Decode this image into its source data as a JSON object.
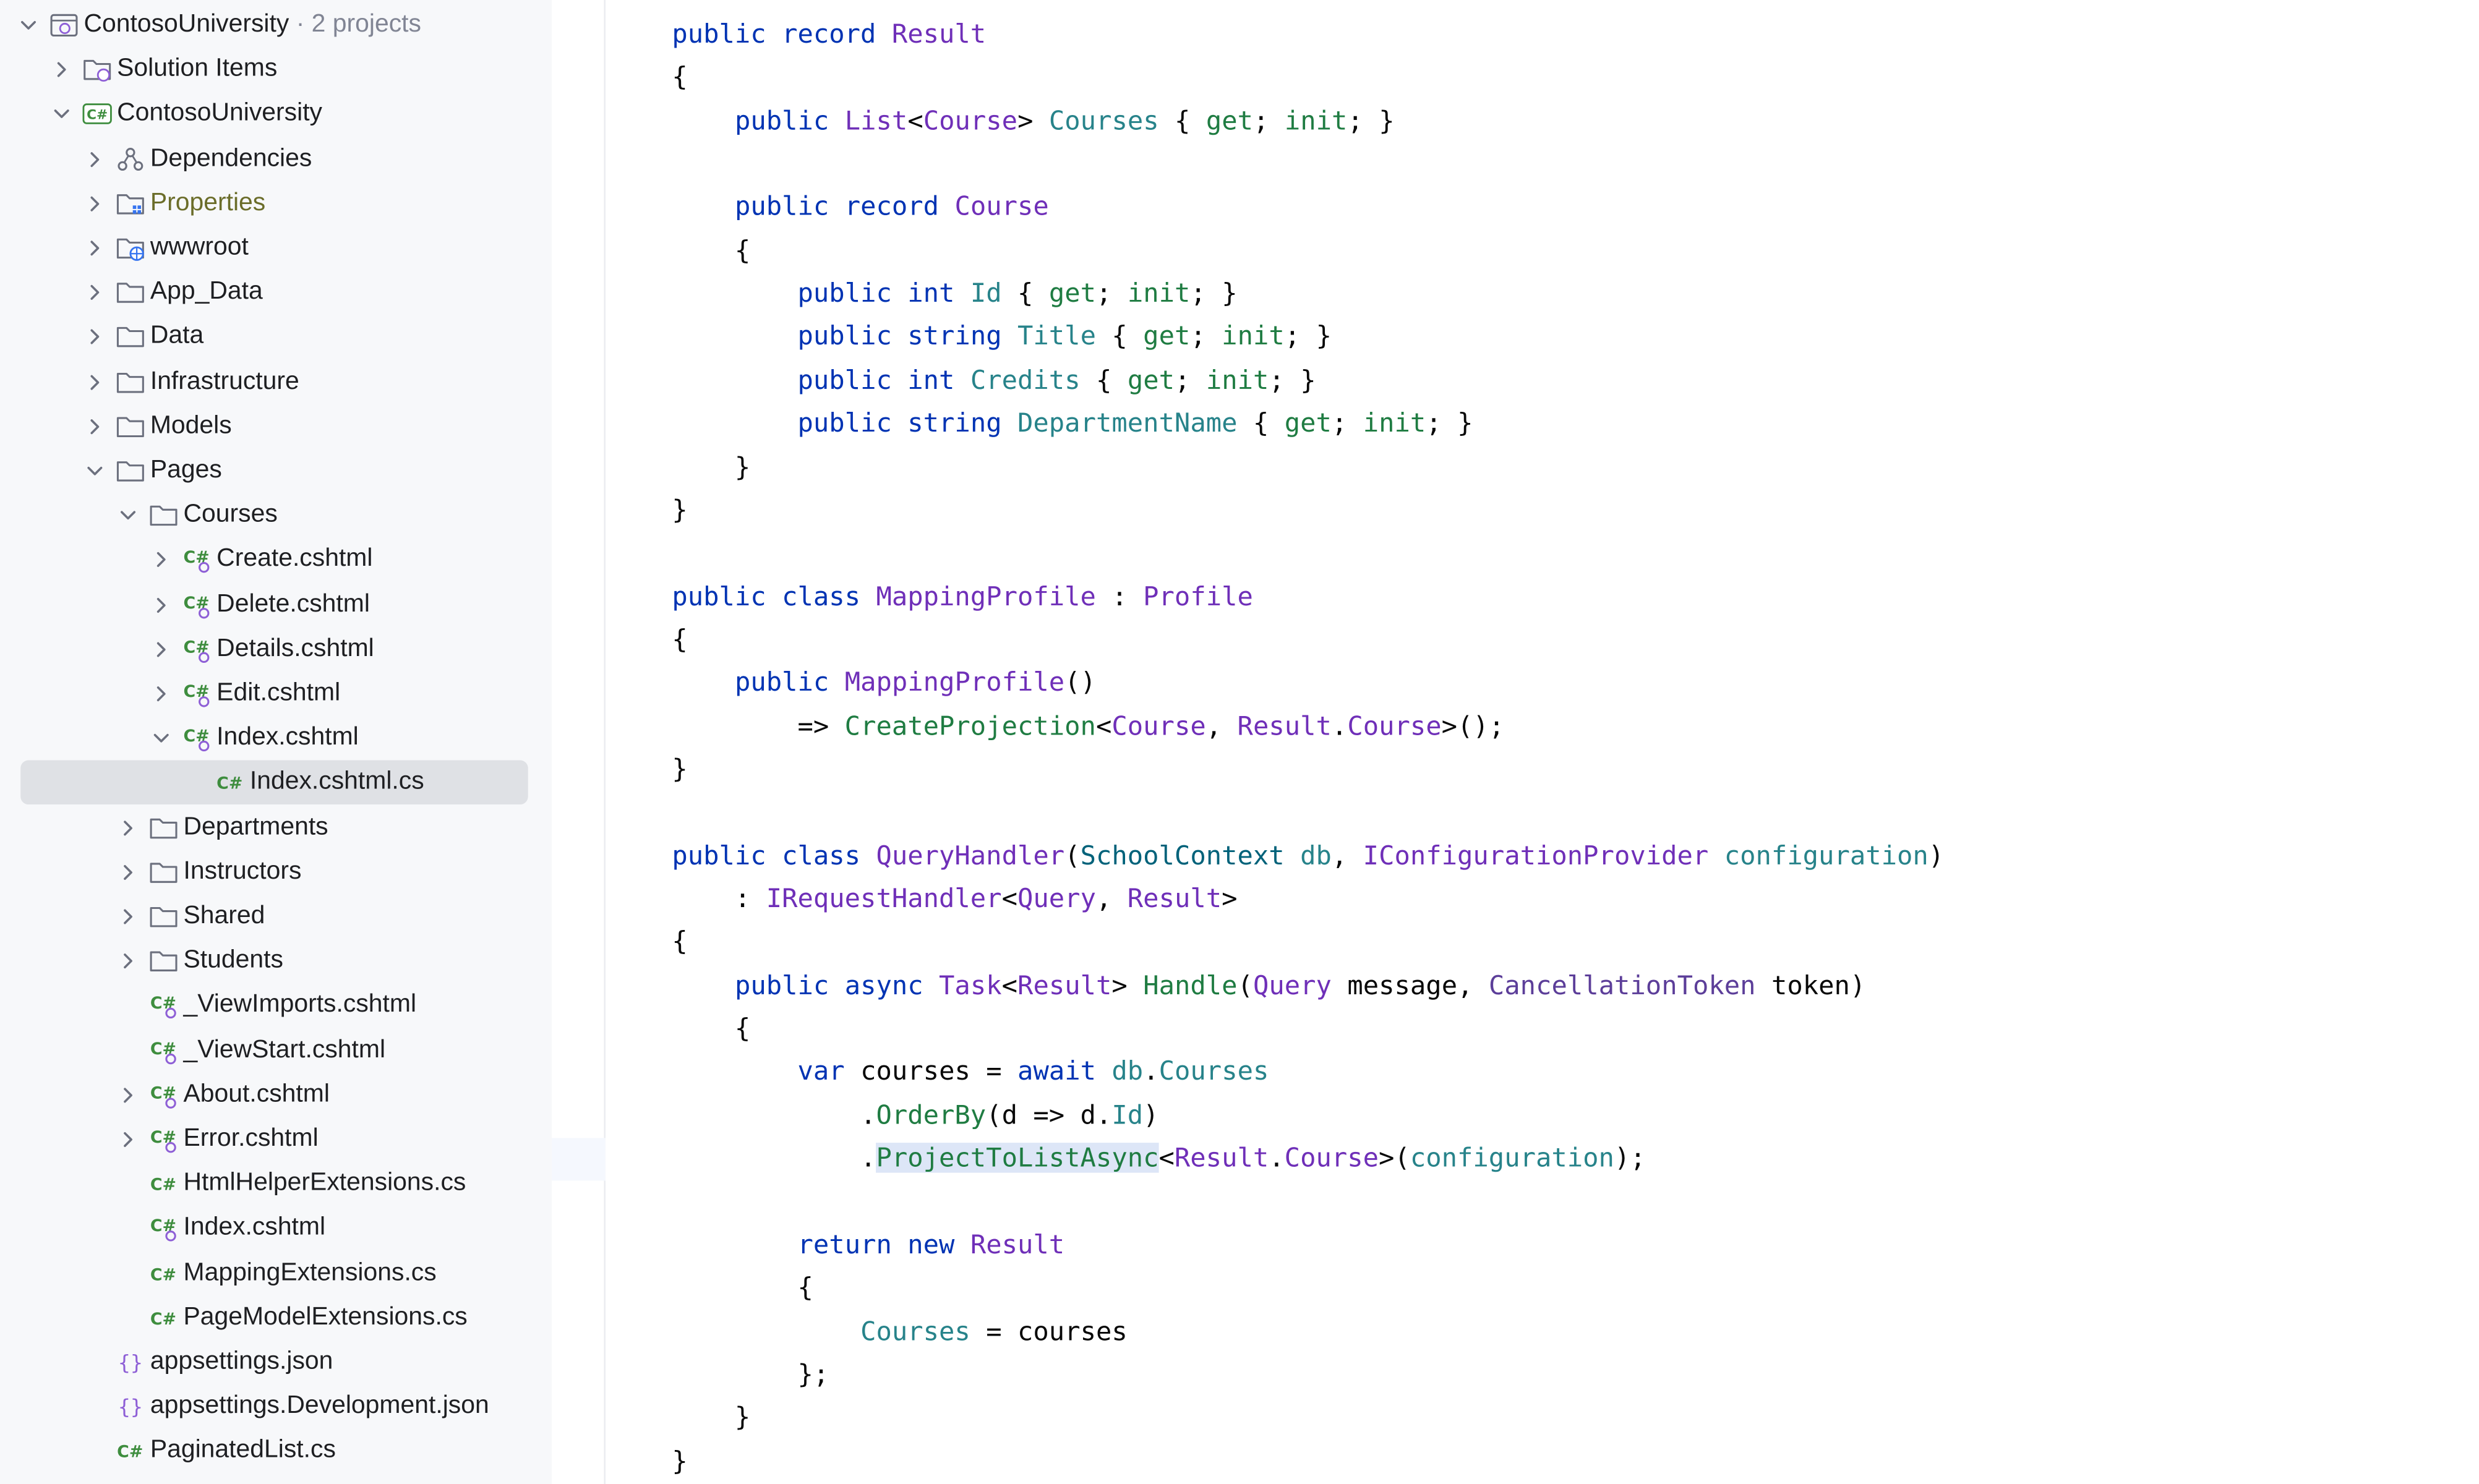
{
  "sidebar": {
    "root": {
      "label": "ContosoUniversity",
      "suffix": " · 2 projects"
    },
    "rows": [
      {
        "label": "Solution Items"
      },
      {
        "label": "ContosoUniversity",
        "badge": "C#"
      },
      {
        "label": "Dependencies"
      },
      {
        "label": "Properties"
      },
      {
        "label": "wwwroot"
      },
      {
        "label": "App_Data"
      },
      {
        "label": "Data"
      },
      {
        "label": "Infrastructure"
      },
      {
        "label": "Models"
      },
      {
        "label": "Pages"
      },
      {
        "label": "Courses"
      },
      {
        "label": "Create.cshtml",
        "badge": "C#"
      },
      {
        "label": "Delete.cshtml",
        "badge": "C#"
      },
      {
        "label": "Details.cshtml",
        "badge": "C#"
      },
      {
        "label": "Edit.cshtml",
        "badge": "C#"
      },
      {
        "label": "Index.cshtml",
        "badge": "C#"
      },
      {
        "label": "Index.cshtml.cs",
        "badge": "C#"
      },
      {
        "label": "Departments"
      },
      {
        "label": "Instructors"
      },
      {
        "label": "Shared"
      },
      {
        "label": "Students"
      },
      {
        "label": "_ViewImports.cshtml",
        "badge": "C#"
      },
      {
        "label": "_ViewStart.cshtml",
        "badge": "C#"
      },
      {
        "label": "About.cshtml",
        "badge": "C#"
      },
      {
        "label": "Error.cshtml",
        "badge": "C#"
      },
      {
        "label": "HtmlHelperExtensions.cs",
        "badge": "C#"
      },
      {
        "label": "Index.cshtml",
        "badge": "C#"
      },
      {
        "label": "MappingExtensions.cs",
        "badge": "C#"
      },
      {
        "label": "PageModelExtensions.cs",
        "badge": "C#"
      },
      {
        "label": "appsettings.json",
        "badge": "{}"
      },
      {
        "label": "appsettings.Development.json",
        "badge": "{}"
      },
      {
        "label": "PaginatedList.cs",
        "badge": "C#"
      }
    ]
  },
  "colors": {
    "keyword": "#0033b3",
    "type": "#6f2fb8",
    "property": "#27838a",
    "accessor": "#1f7c42",
    "selection": "#dfe1e5",
    "caret_line": "#f5f8fe",
    "identifier_highlight": "#dde6f7"
  },
  "editor": {
    "lines": [
      [
        [
          "kw",
          "public record "
        ],
        [
          "ty",
          "Result"
        ]
      ],
      [
        [
          "pl",
          "{"
        ]
      ],
      [
        [
          "pl",
          "    "
        ],
        [
          "kw",
          "public "
        ],
        [
          "ty",
          "List"
        ],
        [
          "pl",
          "<"
        ],
        [
          "ty",
          "Course"
        ],
        [
          "pl",
          "> "
        ],
        [
          "pr",
          "Courses"
        ],
        [
          "pl",
          " { "
        ],
        [
          "ac",
          "get"
        ],
        [
          "pl",
          "; "
        ],
        [
          "ac",
          "init"
        ],
        [
          "pl",
          "; }"
        ]
      ],
      [],
      [
        [
          "pl",
          "    "
        ],
        [
          "kw",
          "public record "
        ],
        [
          "ty",
          "Course"
        ]
      ],
      [
        [
          "pl",
          "    {"
        ]
      ],
      [
        [
          "pl",
          "        "
        ],
        [
          "kw",
          "public int "
        ],
        [
          "pr",
          "Id"
        ],
        [
          "pl",
          " { "
        ],
        [
          "ac",
          "get"
        ],
        [
          "pl",
          "; "
        ],
        [
          "ac",
          "init"
        ],
        [
          "pl",
          "; }"
        ]
      ],
      [
        [
          "pl",
          "        "
        ],
        [
          "kw",
          "public string "
        ],
        [
          "pr",
          "Title"
        ],
        [
          "pl",
          " { "
        ],
        [
          "ac",
          "get"
        ],
        [
          "pl",
          "; "
        ],
        [
          "ac",
          "init"
        ],
        [
          "pl",
          "; }"
        ]
      ],
      [
        [
          "pl",
          "        "
        ],
        [
          "kw",
          "public int "
        ],
        [
          "pr",
          "Credits"
        ],
        [
          "pl",
          " { "
        ],
        [
          "ac",
          "get"
        ],
        [
          "pl",
          "; "
        ],
        [
          "ac",
          "init"
        ],
        [
          "pl",
          "; }"
        ]
      ],
      [
        [
          "pl",
          "        "
        ],
        [
          "kw",
          "public string "
        ],
        [
          "pr",
          "DepartmentName"
        ],
        [
          "pl",
          " { "
        ],
        [
          "ac",
          "get"
        ],
        [
          "pl",
          "; "
        ],
        [
          "ac",
          "init"
        ],
        [
          "pl",
          "; }"
        ]
      ],
      [
        [
          "pl",
          "    }"
        ]
      ],
      [
        [
          "pl",
          "}"
        ]
      ],
      [],
      [
        [
          "kw",
          "public class "
        ],
        [
          "ty",
          "MappingProfile"
        ],
        [
          "pl",
          " : "
        ],
        [
          "ty",
          "Profile"
        ]
      ],
      [
        [
          "pl",
          "{"
        ]
      ],
      [
        [
          "pl",
          "    "
        ],
        [
          "kw",
          "public "
        ],
        [
          "ty",
          "MappingProfile"
        ],
        [
          "pl",
          "()"
        ]
      ],
      [
        [
          "pl",
          "        => "
        ],
        [
          "ac",
          "CreateProjection"
        ],
        [
          "pl",
          "<"
        ],
        [
          "ty",
          "Course"
        ],
        [
          "pl",
          ", "
        ],
        [
          "ty",
          "Result"
        ],
        [
          "pl",
          "."
        ],
        [
          "ty",
          "Course"
        ],
        [
          "pl",
          ">();"
        ]
      ],
      [
        [
          "pl",
          "}"
        ]
      ],
      [],
      [
        [
          "kw",
          "public class "
        ],
        [
          "ty",
          "QueryHandler"
        ],
        [
          "pl",
          "("
        ],
        [
          "st",
          "SchoolContext "
        ],
        [
          "pr",
          "db"
        ],
        [
          "pl",
          ", "
        ],
        [
          "ty",
          "IConfigurationProvider "
        ],
        [
          "pr",
          "configuration"
        ],
        [
          "pl",
          ")"
        ]
      ],
      [
        [
          "pl",
          "    : "
        ],
        [
          "ty",
          "IRequestHandler"
        ],
        [
          "pl",
          "<"
        ],
        [
          "ty",
          "Query"
        ],
        [
          "pl",
          ", "
        ],
        [
          "ty",
          "Result"
        ],
        [
          "pl",
          ">"
        ]
      ],
      [
        [
          "pl",
          "{"
        ]
      ],
      [
        [
          "pl",
          "    "
        ],
        [
          "kw",
          "public async "
        ],
        [
          "ty",
          "Task"
        ],
        [
          "pl",
          "<"
        ],
        [
          "ty",
          "Result"
        ],
        [
          "pl",
          "> "
        ],
        [
          "ac",
          "Handle"
        ],
        [
          "pl",
          "("
        ],
        [
          "ty",
          "Query"
        ],
        [
          "pl",
          " message, "
        ],
        [
          "mt",
          "CancellationToken"
        ],
        [
          "pl",
          " token)"
        ]
      ],
      [
        [
          "pl",
          "    {"
        ]
      ],
      [
        [
          "pl",
          "        "
        ],
        [
          "kw",
          "var "
        ],
        [
          "pl",
          "courses = "
        ],
        [
          "kw",
          "await "
        ],
        [
          "pr",
          "db"
        ],
        [
          "pl",
          "."
        ],
        [
          "pr",
          "Courses"
        ]
      ],
      [
        [
          "pl",
          "            ."
        ],
        [
          "ac",
          "OrderBy"
        ],
        [
          "pl",
          "(d => d."
        ],
        [
          "pr",
          "Id"
        ],
        [
          "pl",
          ")"
        ]
      ],
      [
        [
          "pl",
          "            ."
        ],
        [
          "hl",
          "ProjectToListAsync"
        ],
        [
          "pl",
          "<"
        ],
        [
          "ty",
          "Result"
        ],
        [
          "pl",
          "."
        ],
        [
          "ty",
          "Course"
        ],
        [
          "pl",
          ">("
        ],
        [
          "pr",
          "configuration"
        ],
        [
          "pl",
          ");"
        ]
      ],
      [],
      [
        [
          "pl",
          "        "
        ],
        [
          "kw",
          "return new "
        ],
        [
          "ty",
          "Result"
        ]
      ],
      [
        [
          "pl",
          "        {"
        ]
      ],
      [
        [
          "pl",
          "            "
        ],
        [
          "pr",
          "Courses"
        ],
        [
          "pl",
          " = courses"
        ]
      ],
      [
        [
          "pl",
          "        };"
        ]
      ],
      [
        [
          "pl",
          "    }"
        ]
      ],
      [
        [
          "pl",
          "}"
        ]
      ]
    ]
  }
}
